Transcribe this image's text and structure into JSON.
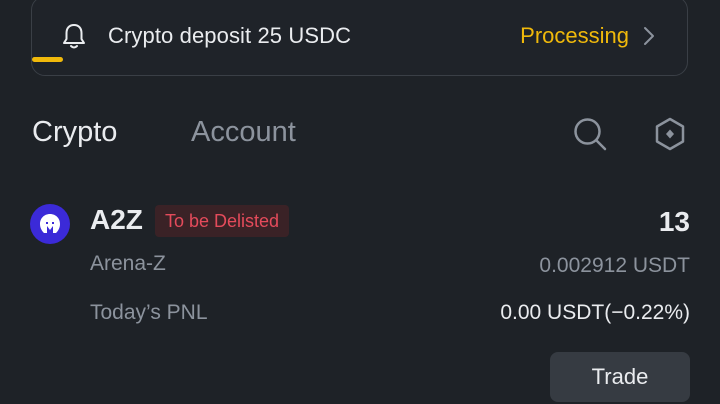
{
  "banner": {
    "message": "Crypto deposit 25 USDC",
    "status": "Processing",
    "status_color": "#f0b90b",
    "icon": "bell-icon"
  },
  "tabs": [
    {
      "label": "Crypto",
      "active": true
    },
    {
      "label": "Account",
      "active": false
    }
  ],
  "toolbar": {
    "search_icon": "search-icon",
    "settings_icon": "hexagon-settings-icon"
  },
  "asset": {
    "symbol": "A2Z",
    "badge": "To be Delisted",
    "name": "Arena-Z",
    "amount": "13",
    "value": "0.002912 USDT",
    "pnl_label": "Today’s PNL",
    "pnl_value": "0.00 USDT(−0.22%)",
    "trade_label": "Trade"
  },
  "colors": {
    "accent": "#f0b90b",
    "danger": "#e44b5b",
    "background": "#1e2227"
  }
}
